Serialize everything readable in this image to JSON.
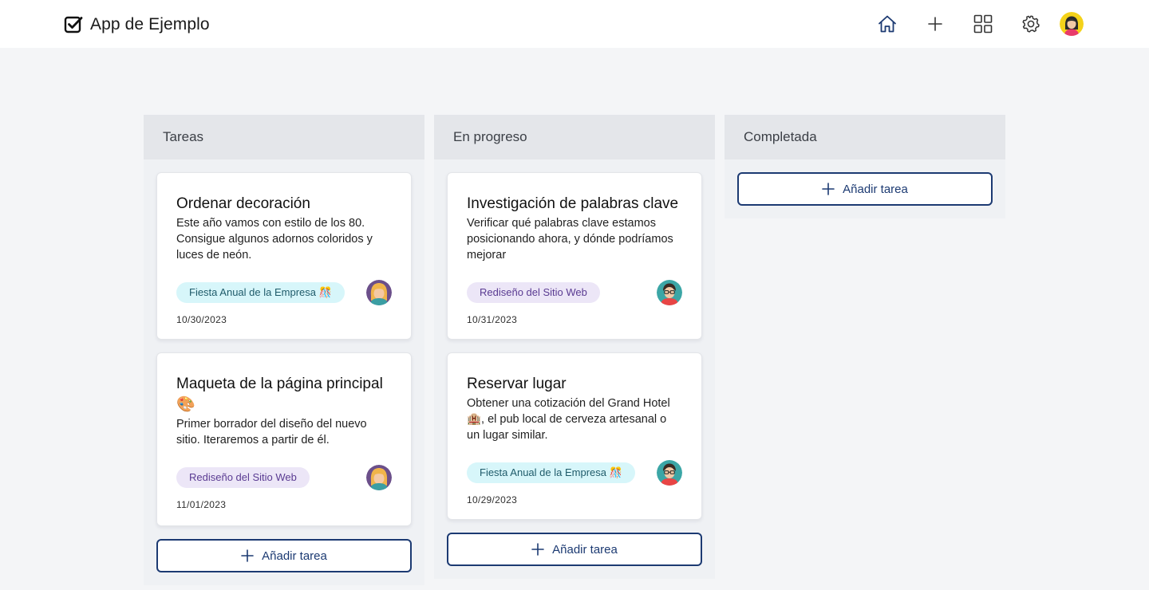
{
  "app": {
    "title": "App de Ejemplo",
    "logo_icon": "checkbox-icon",
    "nav_icons": [
      "home-icon",
      "plus-icon",
      "grid-icon",
      "gear-icon",
      "user-avatar"
    ]
  },
  "colors": {
    "accent": "#1c3a72",
    "tag_cyan_bg": "#d7f6fa",
    "tag_purple_bg": "#ece6f7"
  },
  "columns": [
    {
      "title": "Tareas",
      "add_label": "Añadir tarea",
      "cards": [
        {
          "title": "Ordenar decoración",
          "description": "Este año vamos con estilo de los 80. Consigue algunos adornos coloridos y luces de neón.",
          "tag": "Fiesta Anual de la Empresa 🎊",
          "date": "10/30/2023",
          "assignee_icon": "blonde-woman-avatar"
        },
        {
          "title": "Maqueta de la página principal 🎨",
          "description": "Primer borrador del diseño del nuevo sitio. Iteraremos a partir de él.",
          "tag": "Rediseño del Sitio Web",
          "date": "11/01/2023",
          "assignee_icon": "blonde-woman-avatar"
        }
      ]
    },
    {
      "title": "En progreso",
      "add_label": "Añadir tarea",
      "cards": [
        {
          "title": "Investigación de palabras clave",
          "description": "Verificar qué palabras clave estamos posicionando ahora, y dónde podríamos mejorar",
          "tag": "Rediseño del Sitio Web",
          "date": "10/31/2023",
          "assignee_icon": "man-with-glasses-avatar"
        },
        {
          "title": "Reservar lugar",
          "description": "Obtener una cotización del Grand Hotel 🏨, el pub local de cerveza artesanal o un lugar similar.",
          "tag": "Fiesta Anual de la Empresa 🎊",
          "date": "10/29/2023",
          "assignee_icon": "man-with-glasses-avatar"
        }
      ]
    },
    {
      "title": "Completada",
      "add_label": "Añadir tarea",
      "cards": []
    }
  ]
}
